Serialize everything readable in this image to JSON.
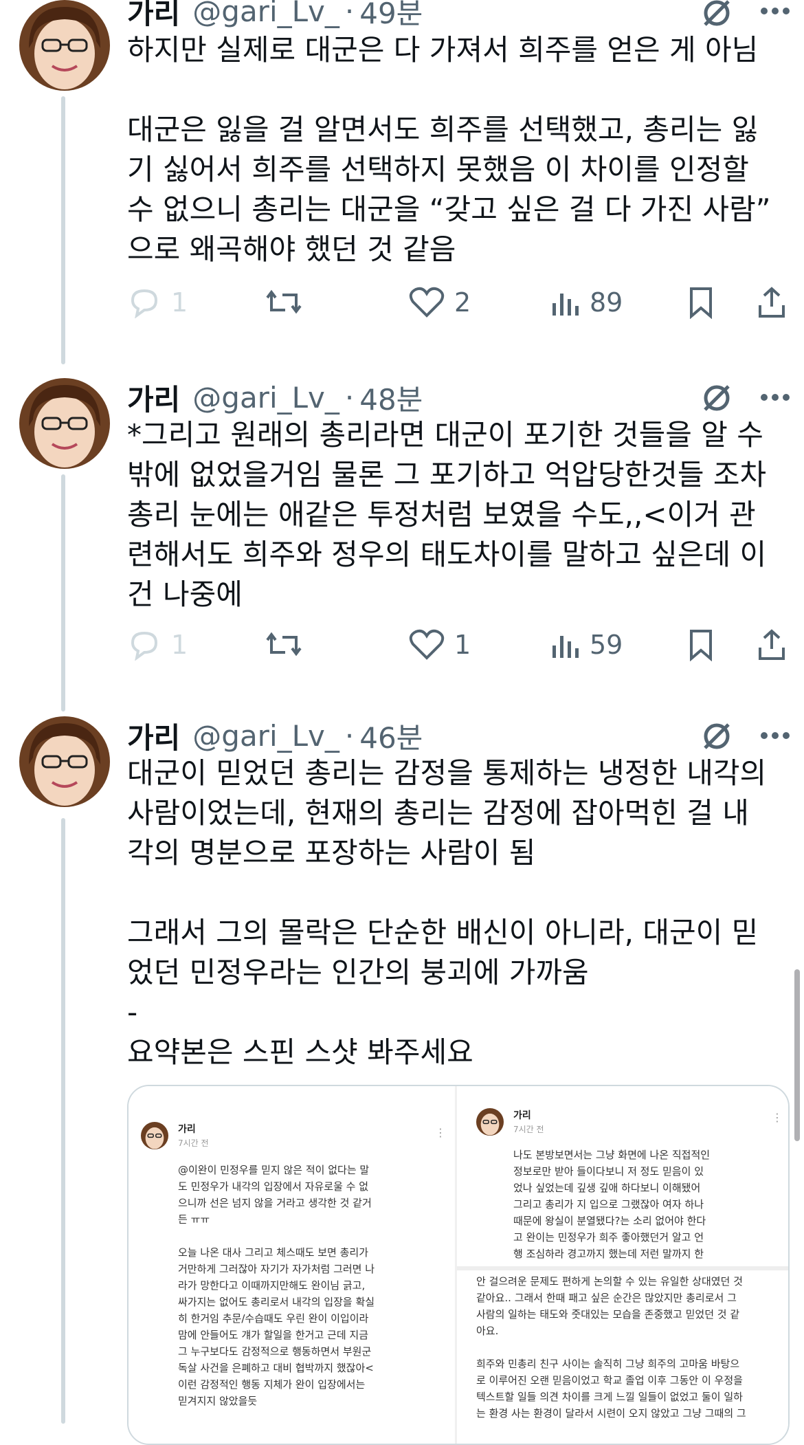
{
  "tweets": [
    {
      "name": "가리",
      "handle": "@gari_Lv_",
      "dot": "·",
      "time": "49분",
      "text": "하지만 실제로 대군은 다 가져서 희주를 얻은 게 아님\n\n대군은 잃을 걸 알면서도 희주를 선택했고, 총리는 잃\n기 싫어서 희주를 선택하지 못했음 이 차이를 인정할\n수 없으니 총리는 대군을 “갖고 싶은 걸 다 가진 사람”\n으로 왜곡해야 했던 것 같음",
      "replies": "1",
      "retweets": "",
      "likes": "2",
      "views": "89"
    },
    {
      "name": "가리",
      "handle": "@gari_Lv_",
      "dot": "·",
      "time": "48분",
      "text": "*그리고 원래의 총리라면 대군이 포기한 것들을 알 수\n밖에 없었을거임 물론 그 포기하고 억압당한것들 조차\n총리 눈에는 애같은 투정처럼 보였을 수도,,<이거 관\n련해서도 희주와 정우의 태도차이를 말하고 싶은데 이\n건 나중에",
      "replies": "1",
      "retweets": "",
      "likes": "1",
      "views": "59"
    },
    {
      "name": "가리",
      "handle": "@gari_Lv_",
      "dot": "·",
      "time": "46분",
      "text": "대군이 믿었던 총리는 감정을 통제하는 냉정한 내각의\n사람이었는데, 현재의 총리는 감정에 잡아먹힌 걸 내\n각의 명분으로 포장하는 사람이 됨\n\n그래서 그의 몰락은 단순한 배신이 아니라, 대군이 믿\n었던 민정우라는 인간의 붕괴에 가까움\n-\n요약본은 스핀 스샷 봐주세요"
    }
  ],
  "media": {
    "left": {
      "name": "가리",
      "time": "7시간 전",
      "dots": "⋮",
      "text": "@이완이 민정우를 믿지 않은 적이 없다는 말\n도 민정우가 내각의 입장에서 자유로울 수 없\n으니까 선은 넘지 않을 거라고 생각한 것 같거\n든 ㅠㅠ\n\n오늘 나온 대사 그리고 체스때도 보면 총리가\n거만하게 그러잖아 자기가 자가처럼 그러면 나\n라가 망한다고 이때까지만해도 완이님 긁고,\n싸가지는 없어도 총리로서 내각의 입장을 확실\n히 한거임 추문/수습때도 우린 완이 이입이라\n맘에 안들어도 걔가 할일을 한거고 근데 지금\n그 누구보다도 감정적으로 행동하면서 부원군\n독살 사건을 은폐하고 대비 협박까지 했잖아<\n이런 감정적인 행동 지체가 완이 입장에서는\n믿겨지지 않았을듯"
    },
    "right": {
      "name": "가리",
      "time": "7시간 전",
      "dots": "⋮",
      "text_top": "나도 본방보면서는 그냥 화면에 나온 직접적인\n정보로만 받아 들이다보니 저 정도 믿음이 있\n었나 싶었는데 깊생 깊애 하다보니 이해됐어\n그리고 총리가 지 입으로 그랬잖아 여자 하나\n때문에 왕실이 분열됐다?는 소리 없어야 한다\n고 완이는 민정우가 희주 좋아했던거 알고 언\n행 조심하라 경고까지 했는데 저런 말까지 한",
      "text_bottom": "안 걸으려운 문제도 편하게 논의할 수 있는 유일한 상대였던 것\n같아요.. 그래서 한때 패고 싶은 순간은 많았지만 총리로서 그\n사람의 일하는 태도와 줏대있는 모습을 존중했고 믿었던 것 같\n아요.\n\n희주와 민총리 친구 사이는 솔직히 그냥 희주의 고마움 바탕으\n로 이루어진 오랜 믿음이었고 학교 졸업 이후 그동안 이 우정을\n텍스트할 일들 의견 차이를 크게 느낄 일들이 없었고 둘이 일하\n는 환경 사는 환경이 달라서 시련이 오지 않았고 그냥 그때의 그"
    }
  },
  "colors": {
    "text": "#0f1419",
    "secondary": "#536471",
    "thread_line": "#cfd9de",
    "grok_icon": "#536471"
  },
  "icons": [
    "avatar",
    "grok-icon",
    "more-icon",
    "reply-icon",
    "retweet-icon",
    "like-icon",
    "views-icon",
    "bookmark-icon",
    "share-icon"
  ]
}
